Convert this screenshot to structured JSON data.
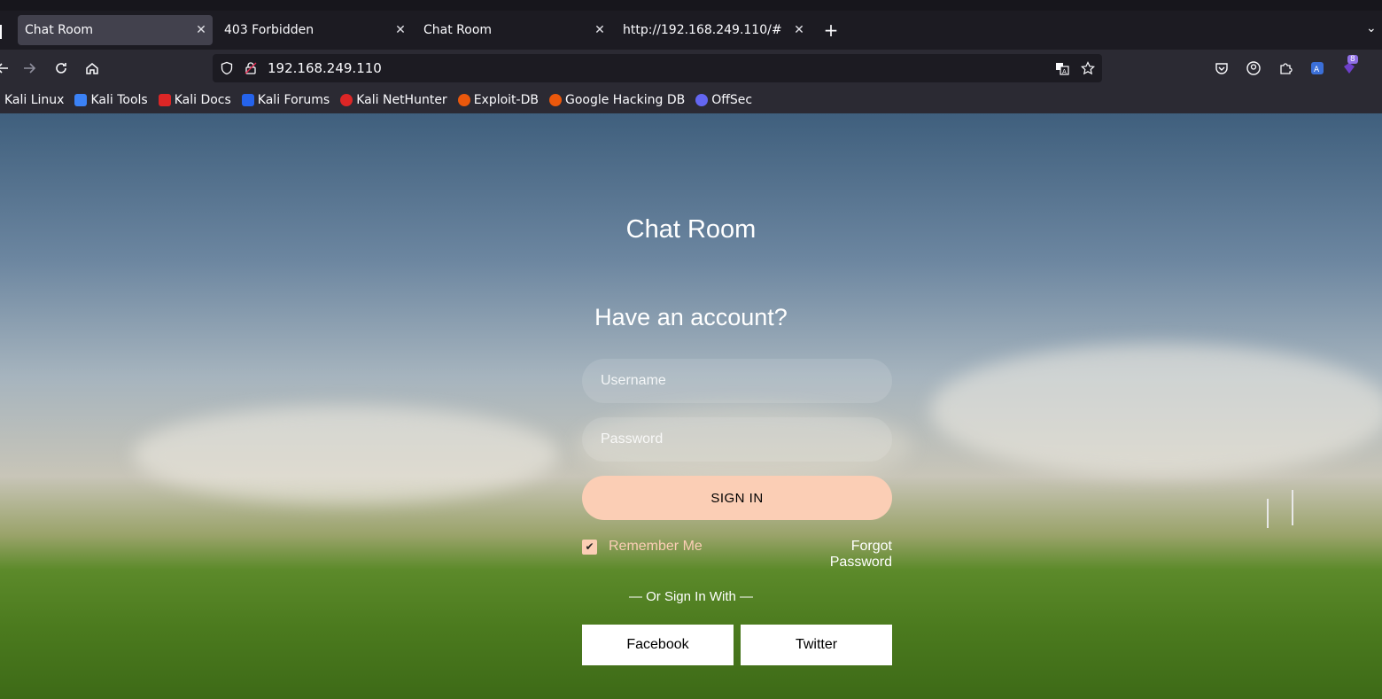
{
  "browser": {
    "tabs": [
      {
        "title": "Chat Room",
        "active": true
      },
      {
        "title": "403 Forbidden",
        "active": false
      },
      {
        "title": "Chat Room",
        "active": false
      },
      {
        "title": "http://192.168.249.110/#",
        "active": false
      }
    ],
    "url": "192.168.249.110",
    "extension_badge": "8",
    "bookmarks": [
      {
        "label": "Kali Linux",
        "icon": "kali-linux-icon",
        "color": ""
      },
      {
        "label": "Kali Tools",
        "icon": "kali-tools-icon",
        "color": "#3b82f6"
      },
      {
        "label": "Kali Docs",
        "icon": "kali-docs-icon",
        "color": "#dc2626"
      },
      {
        "label": "Kali Forums",
        "icon": "kali-forums-icon",
        "color": "#2563eb"
      },
      {
        "label": "Kali NetHunter",
        "icon": "kali-nethunter-icon",
        "color": "#dc2626"
      },
      {
        "label": "Exploit-DB",
        "icon": "exploit-db-icon",
        "color": "#ea580c"
      },
      {
        "label": "Google Hacking DB",
        "icon": "ghdb-icon",
        "color": "#ea580c"
      },
      {
        "label": "OffSec",
        "icon": "offsec-icon",
        "color": "#6366f1"
      }
    ]
  },
  "login": {
    "app_title": "Chat Room",
    "heading": "Have an account?",
    "username_placeholder": "Username",
    "password_placeholder": "Password",
    "sign_in_label": "SIGN IN",
    "remember_label": "Remember Me",
    "remember_checked": true,
    "forgot_label": "Forgot Password",
    "or_sign_in_label": "— Or Sign In With —",
    "facebook_label": "Facebook",
    "twitter_label": "Twitter"
  },
  "colors": {
    "accent": "#fbceb5",
    "browser_bg": "#2b2a33"
  }
}
